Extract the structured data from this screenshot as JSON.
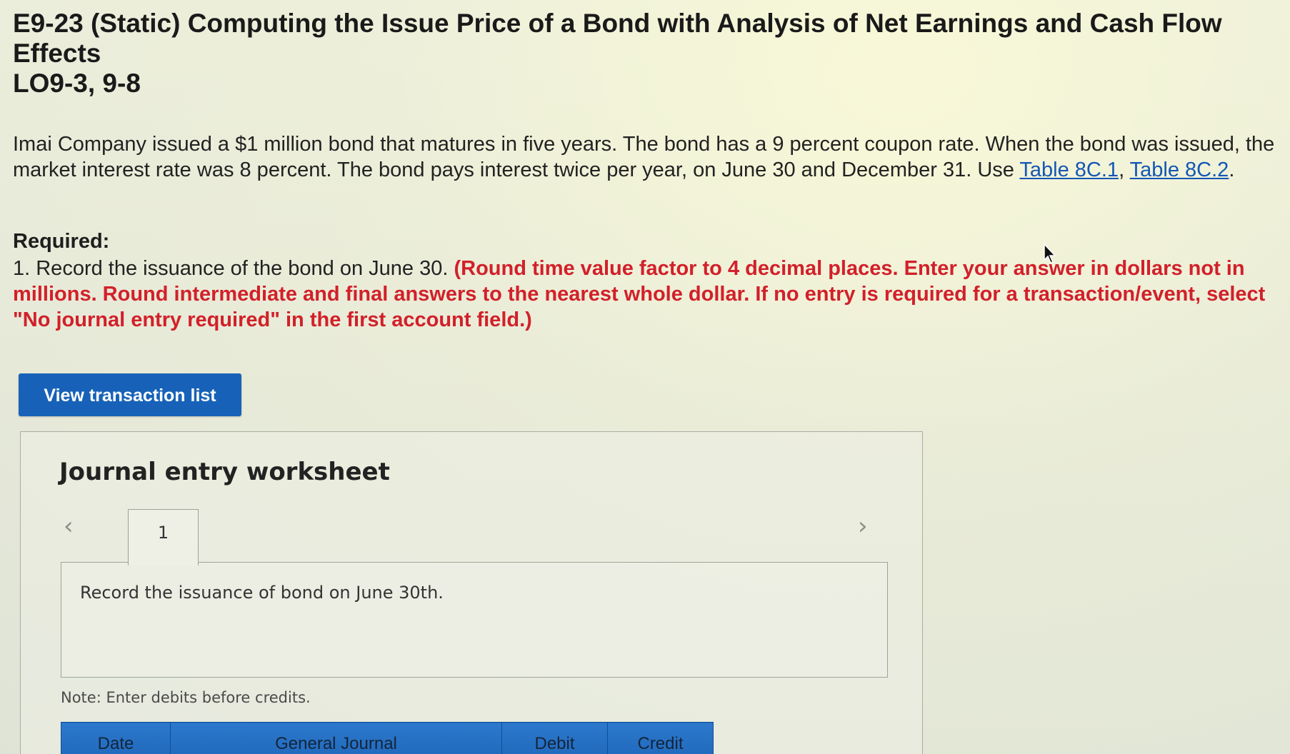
{
  "header": {
    "title_line1": "E9-23 (Static) Computing the Issue Price of a Bond with Analysis of Net Earnings and Cash Flow Effects",
    "title_line2": "LO9-3, 9-8"
  },
  "problem": {
    "intro_text": "Imai Company issued a $1 million bond that matures in five years. The bond has a 9 percent coupon rate. When the bond was issued, the market interest rate was 8 percent. The bond pays interest twice per year, on June 30 and December 31. Use ",
    "link1": "Table 8C.1",
    "separator": ", ",
    "link2": "Table 8C.2",
    "end": "."
  },
  "required": {
    "heading": "Required:",
    "item_text": "1. Record the issuance of the bond on June 30. ",
    "item_emphasis": "(Round time value factor to 4 decimal places. Enter your answer in dollars not in millions. Round intermediate and final answers to the nearest whole dollar. If no entry is required for a transaction/event, select \"No journal entry required\" in the first account field.)"
  },
  "buttons": {
    "view_transactions": "View transaction list"
  },
  "worksheet": {
    "title": "Journal entry worksheet",
    "prev_icon": "‹",
    "next_icon": "›",
    "tab_label": "1",
    "instruction": "Record the issuance of bond on June 30th.",
    "note": "Note: Enter debits before credits.",
    "columns": [
      "Date",
      "General Journal",
      "Debit",
      "Credit"
    ]
  },
  "colors": {
    "button_blue": "#1762b8",
    "link_blue": "#1357b5",
    "emphasis_red": "#d2202a",
    "table_header_blue": "#1e66b9"
  }
}
